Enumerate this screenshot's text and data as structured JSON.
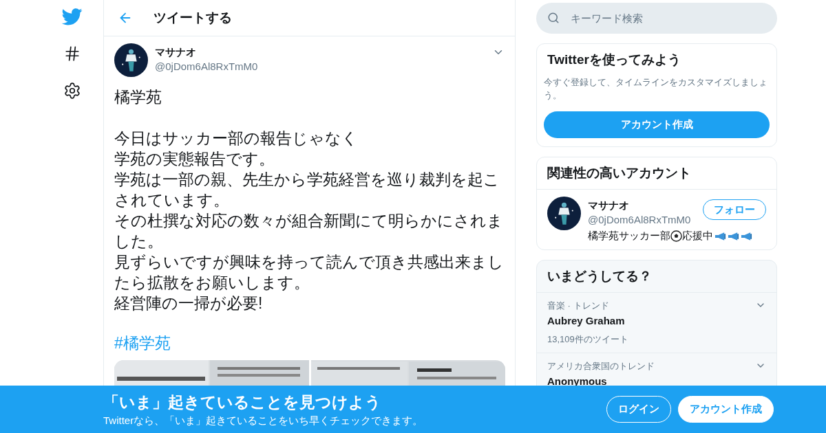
{
  "nav": {
    "title": "ツイートする"
  },
  "tweet": {
    "name": "マサナオ",
    "handle": "@0jDom6Al8RxTmM0",
    "paragraphs": [
      {
        "lines": [
          "橘学苑"
        ]
      },
      {
        "lines": [
          "今日はサッカー部の報告じゃなく",
          "学苑の実態報告です。",
          "学苑は一部の親、先生から学苑経営を巡り裁判を起こされています。",
          "その杜撰な対応の数々が組合新聞にて明らかにされました。",
          "見ずらいですが興味を持って読んで頂き共感出来ましたら拡散をお願いします。",
          "経営陣の一掃が必要!"
        ]
      }
    ],
    "hashtag": "#橘学苑"
  },
  "search": {
    "placeholder": "キーワード検索"
  },
  "signup_card": {
    "title": "Twitterを使ってみよう",
    "text": "今すぐ登録して、タイムラインをカスタマイズしましょう。",
    "button": "アカウント作成"
  },
  "related": {
    "title": "関連性の高いアカウント",
    "accounts": [
      {
        "name": "マサナオ",
        "handle": "@0jDom6Al8RxTmM0",
        "button": "フォロー",
        "bio": [
          {
            "kind": "text",
            "text": "橘学苑サッカー部"
          },
          {
            "kind": "ball"
          },
          {
            "kind": "text",
            "text": "応援中"
          },
          {
            "kind": "megaphone"
          },
          {
            "kind": "megaphone"
          },
          {
            "kind": "megaphone"
          }
        ]
      }
    ]
  },
  "trends": {
    "title": "いまどうしてる？",
    "items": [
      {
        "context": "音楽 · トレンド",
        "name": "Aubrey Graham",
        "count": "13,109件のツイート"
      },
      {
        "context": "アメリカ合衆国のトレンド",
        "name": "Anonymous"
      }
    ]
  },
  "banner": {
    "title": "「いま」起きていることを見つけよう",
    "text": "Twitterなら、「いま」起きていることをいち早くチェックできます。",
    "buttons": [
      {
        "label": "ログイン",
        "kind": "outline"
      },
      {
        "label": "アカウント作成",
        "kind": "solid"
      }
    ]
  }
}
